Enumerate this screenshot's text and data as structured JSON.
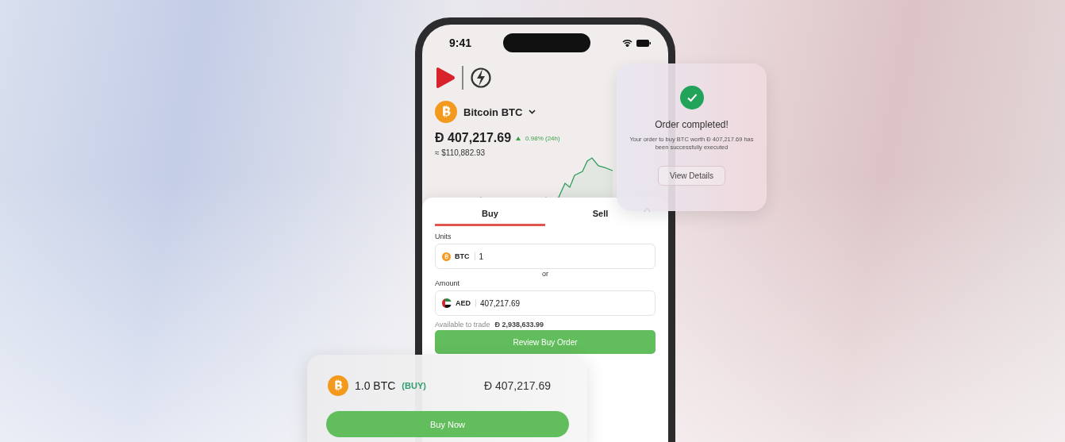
{
  "status_bar": {
    "time": "9:41"
  },
  "asset": {
    "name": "Bitcoin",
    "symbol": "BTC",
    "price": "Đ 407,217.69",
    "change": "0.98% (24h)",
    "usd_value": "≈ $110,882.93"
  },
  "trade_panel": {
    "tabs": [
      {
        "label": "Buy",
        "selected": true
      },
      {
        "label": "Sell",
        "selected": false
      }
    ],
    "units": {
      "label": "Units",
      "currency": "BTC",
      "value": "1"
    },
    "separator": "or",
    "amount": {
      "label": "Amount",
      "currency": "AED",
      "value": "407,217.69"
    },
    "available": {
      "label": "Available to trade",
      "value": "Đ 2,938,633.99"
    },
    "button": "Review Buy Order"
  },
  "notification": {
    "title": "Order completed!",
    "message": "Your order to buy BTC worth Đ 407,217.69 has been successfully executed",
    "button": "View Details"
  },
  "order_card": {
    "quantity": "1.0 BTC",
    "side": "(BUY)",
    "price": "Đ 407,217.69",
    "button": "Buy Now"
  }
}
